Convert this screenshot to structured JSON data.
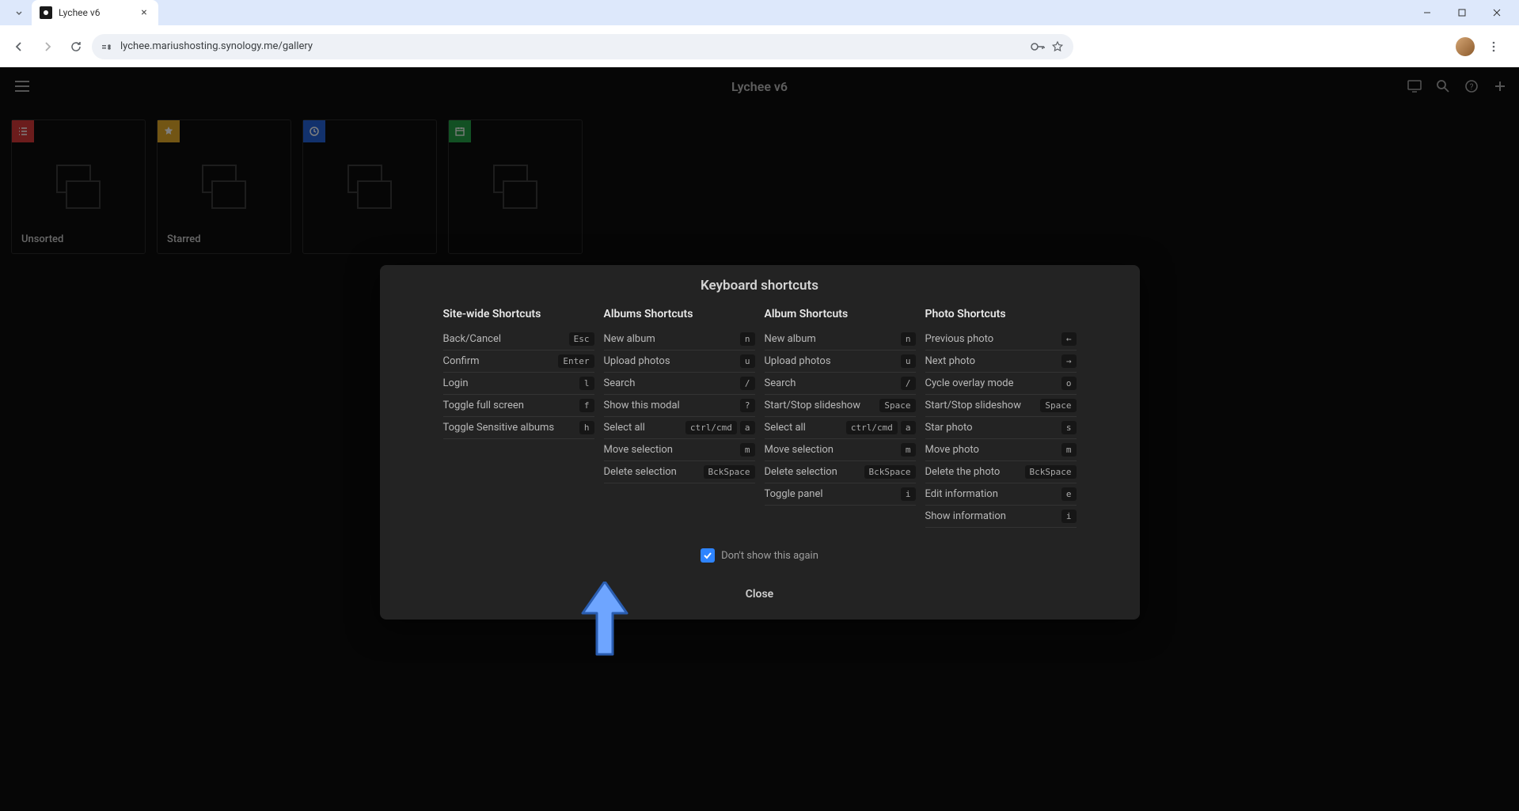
{
  "browser": {
    "tab_title": "Lychee v6",
    "url": "lychee.mariushosting.synology.me/gallery"
  },
  "app": {
    "title": "Lychee v6"
  },
  "albums": [
    {
      "label": "Unsorted",
      "badge": "red"
    },
    {
      "label": "Starred",
      "badge": "yellow"
    },
    {
      "label": "",
      "badge": "blue"
    },
    {
      "label": "",
      "badge": "green"
    }
  ],
  "modal": {
    "title": "Keyboard shortcuts",
    "columns": [
      {
        "title": "Site-wide Shortcuts",
        "rows": [
          {
            "label": "Back/Cancel",
            "keys": [
              "Esc"
            ]
          },
          {
            "label": "Confirm",
            "keys": [
              "Enter"
            ]
          },
          {
            "label": "Login",
            "keys": [
              "l"
            ]
          },
          {
            "label": "Toggle full screen",
            "keys": [
              "f"
            ]
          },
          {
            "label": "Toggle Sensitive albums",
            "keys": [
              "h"
            ]
          }
        ]
      },
      {
        "title": "Albums Shortcuts",
        "rows": [
          {
            "label": "New album",
            "keys": [
              "n"
            ]
          },
          {
            "label": "Upload photos",
            "keys": [
              "u"
            ]
          },
          {
            "label": "Search",
            "keys": [
              "/"
            ]
          },
          {
            "label": "Show this modal",
            "keys": [
              "?"
            ]
          },
          {
            "label": "Select all",
            "keys": [
              "ctrl/cmd",
              "a"
            ]
          },
          {
            "label": "Move selection",
            "keys": [
              "m"
            ]
          },
          {
            "label": "Delete selection",
            "keys": [
              "BckSpace"
            ]
          }
        ]
      },
      {
        "title": "Album Shortcuts",
        "rows": [
          {
            "label": "New album",
            "keys": [
              "n"
            ]
          },
          {
            "label": "Upload photos",
            "keys": [
              "u"
            ]
          },
          {
            "label": "Search",
            "keys": [
              "/"
            ]
          },
          {
            "label": "Start/Stop slideshow",
            "keys": [
              "Space"
            ]
          },
          {
            "label": "Select all",
            "keys": [
              "ctrl/cmd",
              "a"
            ]
          },
          {
            "label": "Move selection",
            "keys": [
              "m"
            ]
          },
          {
            "label": "Delete selection",
            "keys": [
              "BckSpace"
            ]
          },
          {
            "label": "Toggle panel",
            "keys": [
              "i"
            ]
          }
        ]
      },
      {
        "title": "Photo Shortcuts",
        "rows": [
          {
            "label": "Previous photo",
            "keys": [
              "←"
            ]
          },
          {
            "label": "Next photo",
            "keys": [
              "→"
            ]
          },
          {
            "label": "Cycle overlay mode",
            "keys": [
              "o"
            ]
          },
          {
            "label": "Start/Stop slideshow",
            "keys": [
              "Space"
            ]
          },
          {
            "label": "Star photo",
            "keys": [
              "s"
            ]
          },
          {
            "label": "Move photo",
            "keys": [
              "m"
            ]
          },
          {
            "label": "Delete the photo",
            "keys": [
              "BckSpace"
            ]
          },
          {
            "label": "Edit information",
            "keys": [
              "e"
            ]
          },
          {
            "label": "Show information",
            "keys": [
              "i"
            ]
          }
        ]
      }
    ],
    "dont_show_label": "Don't show this again",
    "close_label": "Close"
  }
}
